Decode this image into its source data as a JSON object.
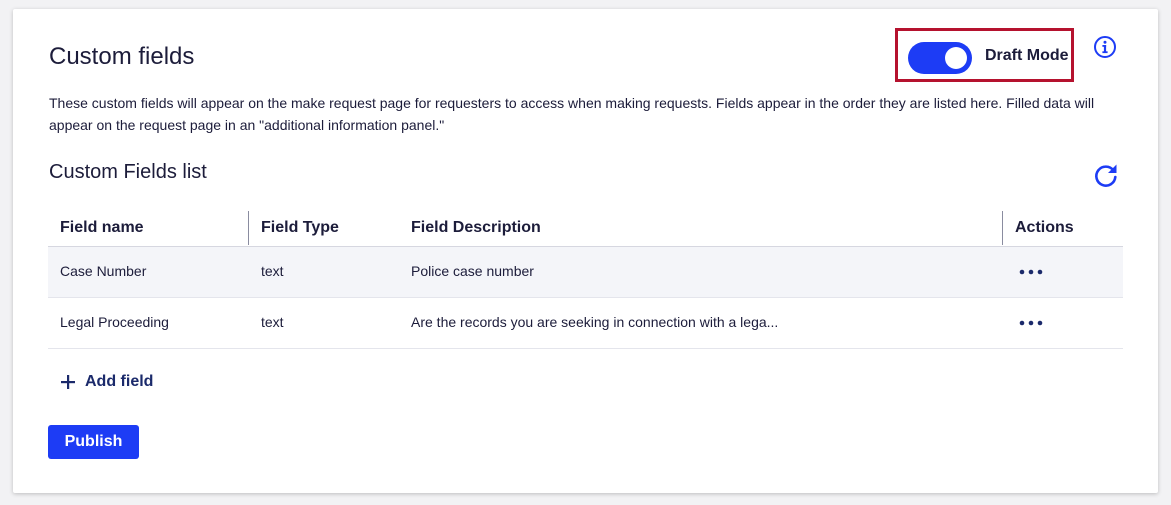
{
  "header": {
    "title": "Custom fields",
    "draft_mode_label": "Draft Mode",
    "draft_mode_on": true
  },
  "description": "These custom fields will appear on the make request page for requesters to access when making requests. Fields appear in the order they are listed here. Filled data will appear on the request page in an \"additional information panel.\"",
  "list": {
    "title": "Custom Fields list",
    "columns": [
      "Field name",
      "Field Type",
      "Field Description",
      "Actions"
    ],
    "rows": [
      {
        "name": "Case Number",
        "type": "text",
        "description": "Police case number"
      },
      {
        "name": "Legal Proceeding",
        "type": "text",
        "description": "Are the records you are seeking in connection with a lega..."
      }
    ]
  },
  "actions": {
    "add_field_label": "Add field",
    "publish_label": "Publish"
  },
  "icons": {
    "info": "info-icon",
    "refresh": "refresh-icon",
    "row_actions": "more-horizontal-icon",
    "add": "plus-icon"
  },
  "colors": {
    "accent": "#1d3cf5",
    "highlight_border": "#b5122e",
    "text": "#1c1c3a"
  }
}
